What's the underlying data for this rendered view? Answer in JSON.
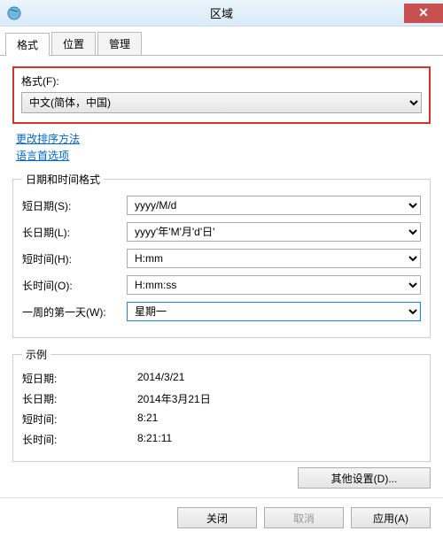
{
  "window": {
    "title": "区域"
  },
  "tabs": [
    "格式",
    "位置",
    "管理"
  ],
  "format": {
    "label": "格式(F):",
    "value": "中文(简体，中国)"
  },
  "links": {
    "sort": "更改排序方法",
    "lang": "语言首选项"
  },
  "datetime": {
    "legend": "日期和时间格式",
    "short_date_label": "短日期(S):",
    "short_date_value": "yyyy/M/d",
    "long_date_label": "长日期(L):",
    "long_date_value": "yyyy'年'M'月'd'日'",
    "short_time_label": "短时间(H):",
    "short_time_value": "H:mm",
    "long_time_label": "长时间(O):",
    "long_time_value": "H:mm:ss",
    "first_day_label": "一周的第一天(W):",
    "first_day_value": "星期一"
  },
  "example": {
    "legend": "示例",
    "short_date_label": "短日期:",
    "short_date_value": "2014/3/21",
    "long_date_label": "长日期:",
    "long_date_value": "2014年3月21日",
    "short_time_label": "短时间:",
    "short_time_value": "8:21",
    "long_time_label": "长时间:",
    "long_time_value": "8:21:11"
  },
  "buttons": {
    "other": "其他设置(D)...",
    "close": "关闭",
    "cancel": "取消",
    "apply": "应用(A)"
  }
}
